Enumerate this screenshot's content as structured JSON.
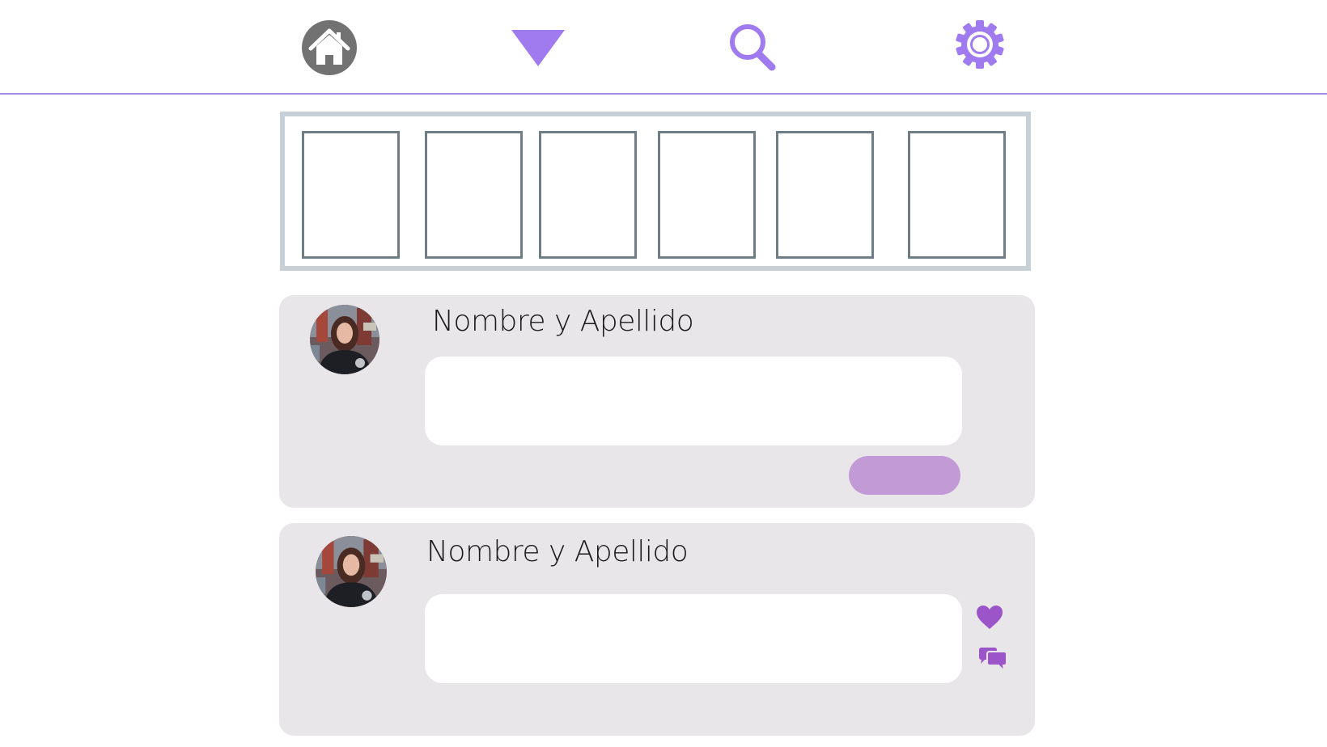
{
  "theme": {
    "accent": "#a07bf0",
    "home_icon_bg": "#727272",
    "divider": "#a98ae8",
    "card_bg": "#e8e6e9",
    "story_frame": "#c7d0d6",
    "story_border": "#6f7d87",
    "publish_button": "#c29ad6",
    "reaction_color": "#9b55c8"
  },
  "nav": {
    "items": [
      {
        "id": "home",
        "icon": "home-icon"
      },
      {
        "id": "dropdown",
        "icon": "triangle-down-icon"
      },
      {
        "id": "search",
        "icon": "search-icon"
      },
      {
        "id": "settings",
        "icon": "gear-icon"
      }
    ]
  },
  "stories": {
    "count": 6
  },
  "composer": {
    "author_name": "Nombre y Apellido",
    "input_value": "",
    "publish_label": ""
  },
  "post": {
    "author_name": "Nombre y Apellido",
    "content": "",
    "actions": [
      "heart-icon",
      "comments-icon"
    ]
  }
}
